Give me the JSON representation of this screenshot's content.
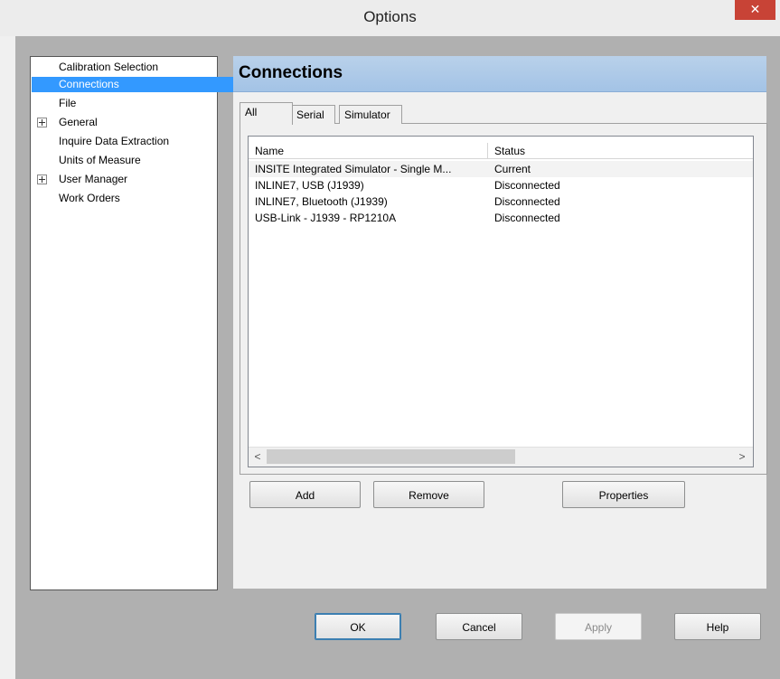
{
  "window": {
    "title": "Options",
    "close_label": "✕"
  },
  "tree": {
    "items": [
      {
        "label": "Calibration Selection",
        "expandable": false,
        "selected": false
      },
      {
        "label": "Connections",
        "expandable": false,
        "selected": true
      },
      {
        "label": "File",
        "expandable": false,
        "selected": false
      },
      {
        "label": "General",
        "expandable": true,
        "selected": false
      },
      {
        "label": "Inquire Data Extraction",
        "expandable": false,
        "selected": false
      },
      {
        "label": "Units of Measure",
        "expandable": false,
        "selected": false
      },
      {
        "label": "User Manager",
        "expandable": true,
        "selected": false
      },
      {
        "label": "Work Orders",
        "expandable": false,
        "selected": false
      }
    ]
  },
  "panel": {
    "title": "Connections"
  },
  "tabs": [
    {
      "label": "All",
      "active": true
    },
    {
      "label": "Serial",
      "active": false
    },
    {
      "label": "Simulator",
      "active": false
    }
  ],
  "list": {
    "columns": [
      "Name",
      "Status"
    ],
    "rows": [
      {
        "name": "INSITE Integrated Simulator - Single M...",
        "status": "Current"
      },
      {
        "name": "INLINE7, USB (J1939)",
        "status": "Disconnected"
      },
      {
        "name": "INLINE7, Bluetooth (J1939)",
        "status": "Disconnected"
      },
      {
        "name": "USB-Link - J1939 - RP1210A",
        "status": "Disconnected"
      }
    ],
    "scroll_left": "<",
    "scroll_right": ">"
  },
  "actions": {
    "add": "Add",
    "remove": "Remove",
    "properties": "Properties"
  },
  "dialog_buttons": {
    "ok": "OK",
    "cancel": "Cancel",
    "apply": "Apply",
    "help": "Help"
  },
  "colors": {
    "selection": "#3399ff",
    "header_gradient": "#b9d1ea",
    "close_button": "#c84336"
  }
}
